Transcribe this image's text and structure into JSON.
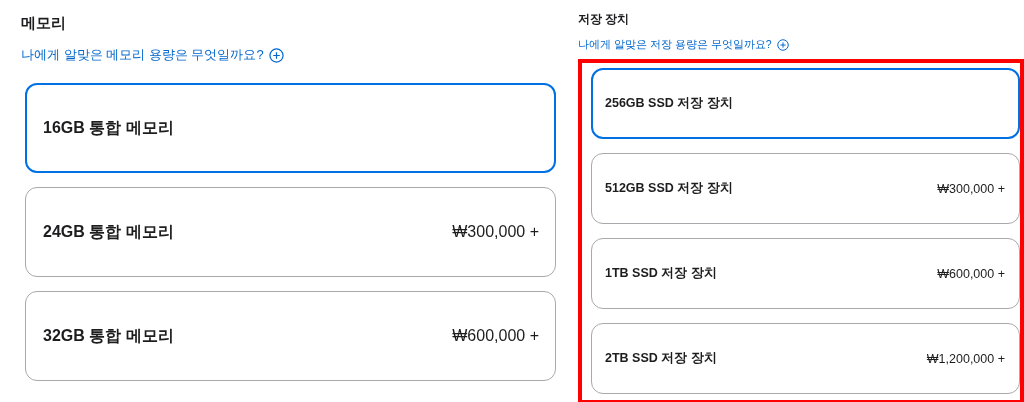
{
  "sections": [
    {
      "title": "메모리",
      "help_link": "나에게 알맞은 메모리 용량은 무엇일까요?",
      "highlighted": false,
      "options": [
        {
          "label": "16GB 통합 메모리",
          "selected": true
        },
        {
          "label": "24GB 통합 메모리",
          "price": "₩300,000 +",
          "selected": false
        },
        {
          "label": "32GB 통합 메모리",
          "price": "₩600,000 +",
          "selected": false
        }
      ]
    },
    {
      "title": "저장 장치",
      "help_link": "나에게 알맞은 저장 용량은 무엇일까요?",
      "highlighted": true,
      "options": [
        {
          "label": "256GB SSD 저장 장치",
          "selected": true
        },
        {
          "label": "512GB SSD 저장 장치",
          "price": "₩300,000 +",
          "selected": false
        },
        {
          "label": "1TB SSD 저장 장치",
          "price": "₩600,000 +",
          "selected": false
        },
        {
          "label": "2TB SSD 저장 장치",
          "price": "₩1,200,000 +",
          "selected": false
        }
      ]
    }
  ]
}
